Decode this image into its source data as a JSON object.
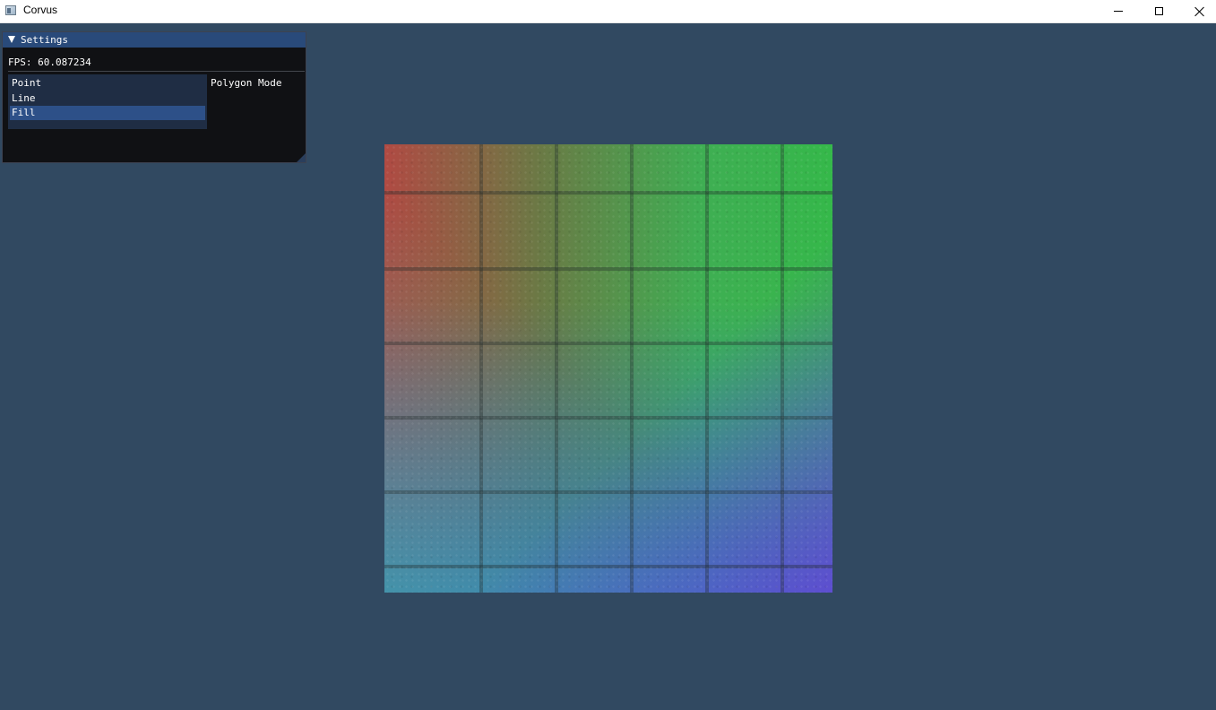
{
  "window": {
    "title": "Corvus",
    "controls": {
      "minimize_icon": "minimize-icon",
      "maximize_icon": "maximize-icon",
      "close_icon": "close-icon"
    }
  },
  "settings_panel": {
    "title": "Settings",
    "collapse_icon": "triangle-down-icon",
    "fps_text": "FPS: 60.087234",
    "polygon_mode": {
      "label": "Polygon Mode",
      "options": [
        "Point",
        "Line",
        "Fill"
      ],
      "selected": "Fill"
    }
  },
  "viewport": {
    "background_color": "#314961",
    "content": "textured-quad"
  },
  "colors": {
    "imgui_titlebar": "#294a7a",
    "imgui_window_bg": "#101114",
    "listbox_bg": "#1f2d44",
    "listbox_selected": "#2d5088"
  }
}
